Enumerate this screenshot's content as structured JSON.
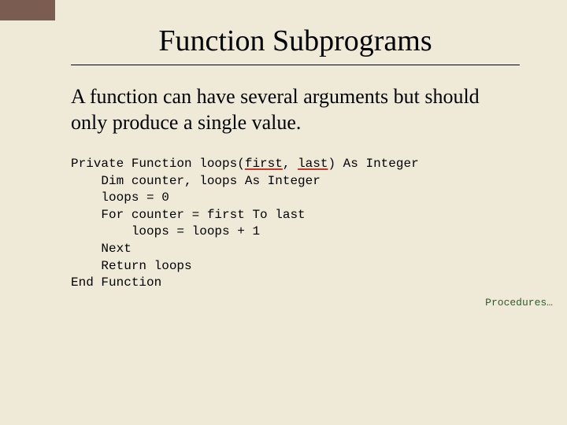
{
  "title": "Function Subprograms",
  "body": "A function can have several arguments but should only produce a single value.",
  "code": {
    "l1a": "Private Function loops(",
    "l1_first": "first",
    "l1b": ", ",
    "l1_last": "last",
    "l1c": ") As Integer",
    "l2": "    Dim counter, loops As Integer",
    "l3": "    loops = 0",
    "l4": "    For counter = first To last",
    "l5": "        loops = loops + 1",
    "l6": "    Next",
    "l7": "    Return loops",
    "l8": "End Function"
  },
  "footer": "Procedures…"
}
